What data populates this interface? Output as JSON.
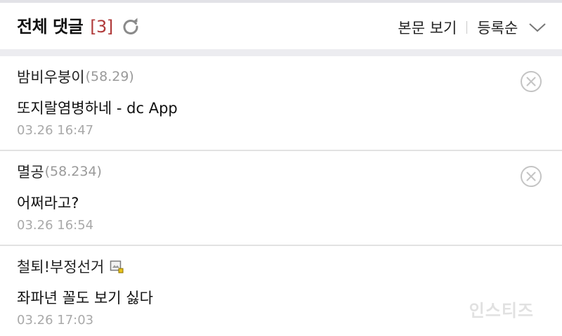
{
  "header": {
    "title": "전체 댓글",
    "count": "[3]",
    "view_post_label": "본문 보기",
    "sort_label": "등록순"
  },
  "comments": [
    {
      "author": "밤비우붕이",
      "ip": "(58.29)",
      "text": "또지랄염병하네 - dc App",
      "date": "03.26 16:47",
      "deletable": true
    },
    {
      "author": "멸공",
      "ip": "(58.234)",
      "text": "어쩌라고?",
      "date": "03.26 16:54",
      "deletable": true
    },
    {
      "author": "철퇴!부정선거",
      "ip": "",
      "text": "좌파년 꼴도 보기 싫다",
      "date": "03.26 17:03",
      "deletable": false,
      "badge_icon": "gallery-icon"
    }
  ],
  "watermark": "인스티즈",
  "colors": {
    "count": "#b03a3a",
    "meta": "#a9a9a9",
    "divider": "#e2e2e2",
    "band": "#ececf0"
  }
}
